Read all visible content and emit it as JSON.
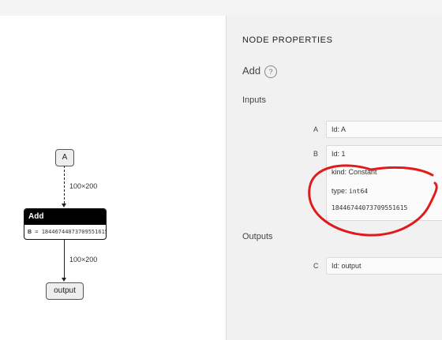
{
  "graph": {
    "node_a": "A",
    "edge_1_label": "100×200",
    "node_add": {
      "title": "Add",
      "attr_name": "B",
      "attr_value": " = 18446744073709551615"
    },
    "edge_2_label": "100×200",
    "node_output": "output"
  },
  "panel": {
    "title": "NODE PROPERTIES",
    "node_type": "Add",
    "help_icon": "?",
    "inputs_label": "Inputs",
    "inputs": [
      {
        "letter": "A",
        "id_label": "Id: ",
        "id_value": "A"
      },
      {
        "letter": "B",
        "id_label": "Id: ",
        "id_value": "1",
        "kind_label": "kind: ",
        "kind_value": "Constant",
        "type_label": "type: ",
        "type_value": "int64",
        "value": "18446744073709551615"
      }
    ],
    "outputs_label": "Outputs",
    "outputs": [
      {
        "letter": "C",
        "id_label": "Id: ",
        "id_value": "output"
      }
    ]
  },
  "annotation_color": "#e01b1b"
}
